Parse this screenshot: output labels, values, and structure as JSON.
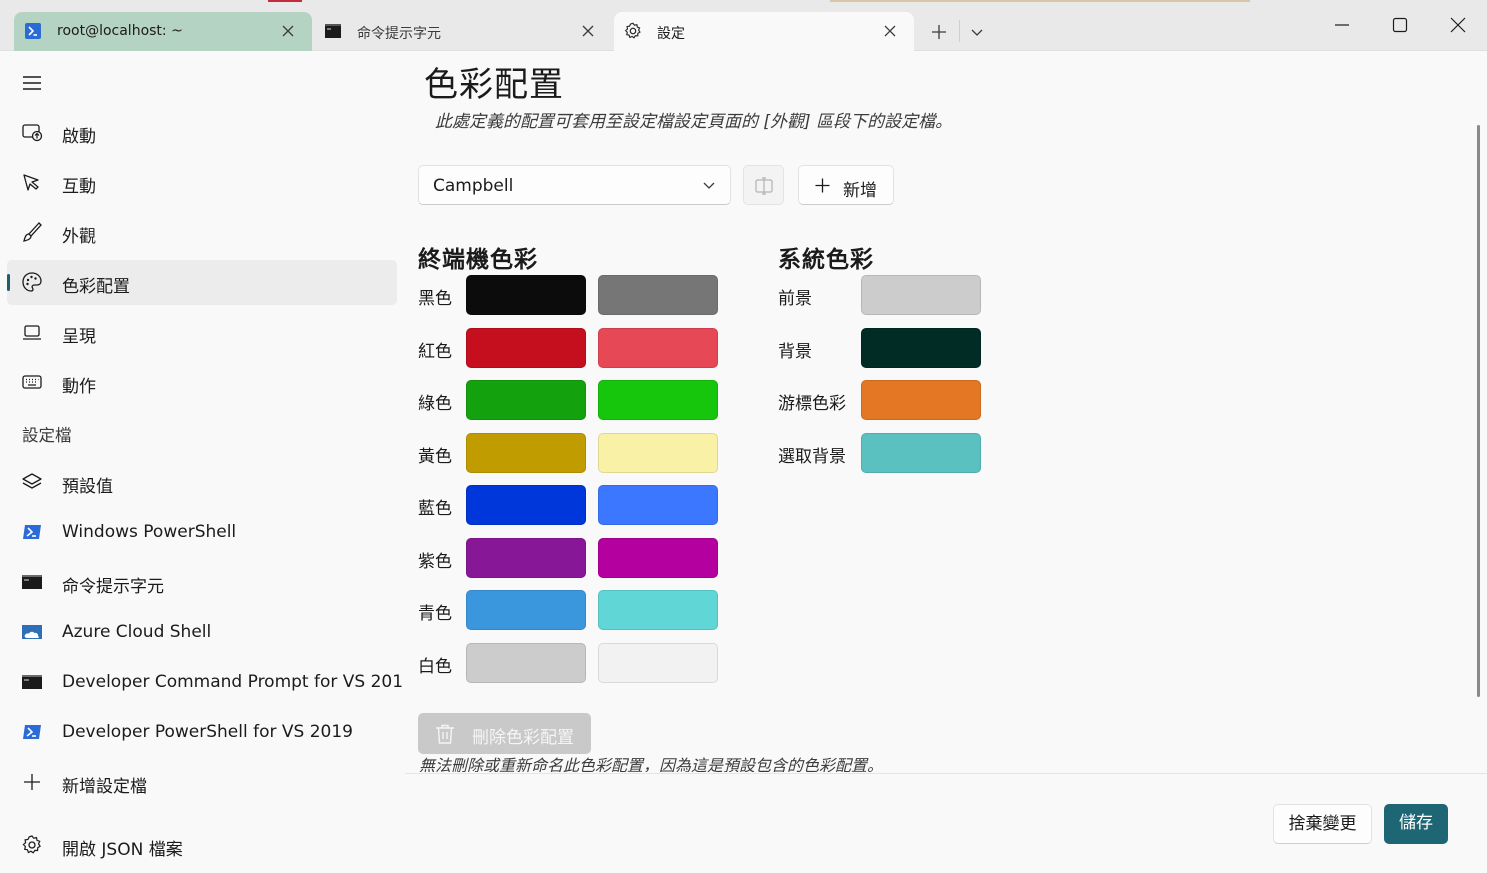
{
  "tabs": [
    {
      "label": "root@localhost: ~",
      "icon": "powershell-icon",
      "active": false
    },
    {
      "label": "命令提示字元",
      "icon": "cmd-icon",
      "active": false
    },
    {
      "label": "設定",
      "icon": "gear-icon",
      "active": true
    }
  ],
  "sidebar": {
    "items": [
      {
        "label": "啟動",
        "icon": "startup-icon"
      },
      {
        "label": "互動",
        "icon": "interaction-icon"
      },
      {
        "label": "外觀",
        "icon": "brush-icon"
      },
      {
        "label": "色彩配置",
        "icon": "palette-icon",
        "selected": true
      },
      {
        "label": "呈現",
        "icon": "laptop-icon"
      },
      {
        "label": "動作",
        "icon": "keyboard-icon"
      }
    ],
    "profiles_header": "設定檔",
    "profiles": [
      {
        "label": "預設值",
        "icon": "layers-icon"
      },
      {
        "label": "Windows PowerShell",
        "icon": "powershell-icon"
      },
      {
        "label": "命令提示字元",
        "icon": "cmd-icon"
      },
      {
        "label": "Azure Cloud Shell",
        "icon": "azure-icon"
      },
      {
        "label": "Developer Command Prompt for VS 201",
        "icon": "cmd-icon"
      },
      {
        "label": "Developer PowerShell for VS 2019",
        "icon": "powershell-icon"
      },
      {
        "label": "新增設定檔",
        "icon": "plus-icon"
      }
    ],
    "open_json": "開啟 JSON 檔案"
  },
  "main": {
    "title": "色彩配置",
    "description": "此處定義的配置可套用至設定檔設定頁面的 [外觀] 區段下的設定檔。",
    "scheme_selected": "Campbell",
    "add_button": "新增",
    "terminal_colors_heading": "終端機色彩",
    "system_colors_heading": "系統色彩",
    "terminal_colors": [
      {
        "label": "黑色",
        "normal": "#0C0C0C",
        "bright": "#767676"
      },
      {
        "label": "紅色",
        "normal": "#C50F1F",
        "bright": "#E74856"
      },
      {
        "label": "綠色",
        "normal": "#13A10E",
        "bright": "#16C60C"
      },
      {
        "label": "黃色",
        "normal": "#C19C00",
        "bright": "#F9F1A5"
      },
      {
        "label": "藍色",
        "normal": "#0037DA",
        "bright": "#3B78FF"
      },
      {
        "label": "紫色",
        "normal": "#881798",
        "bright": "#B4009E"
      },
      {
        "label": "青色",
        "normal": "#3A96DD",
        "bright": "#61D6D6"
      },
      {
        "label": "白色",
        "normal": "#CCCCCC",
        "bright": "#F2F2F2"
      }
    ],
    "system_colors": [
      {
        "label": "前景",
        "color": "#CCCCCC"
      },
      {
        "label": "背景",
        "color": "#012B25"
      },
      {
        "label": "游標色彩",
        "color": "#E37723"
      },
      {
        "label": "選取背景",
        "color": "#5BC0C0"
      }
    ],
    "delete_button": "刪除色彩配置",
    "delete_note": "無法刪除或重新命名此色彩配置，因為這是預設包含的色彩配置。"
  },
  "footer": {
    "discard_button": "捨棄變更",
    "save_button": "儲存"
  },
  "colors": {
    "accent": "#1F6675",
    "active_tab_bg": "#B5D3C3"
  }
}
